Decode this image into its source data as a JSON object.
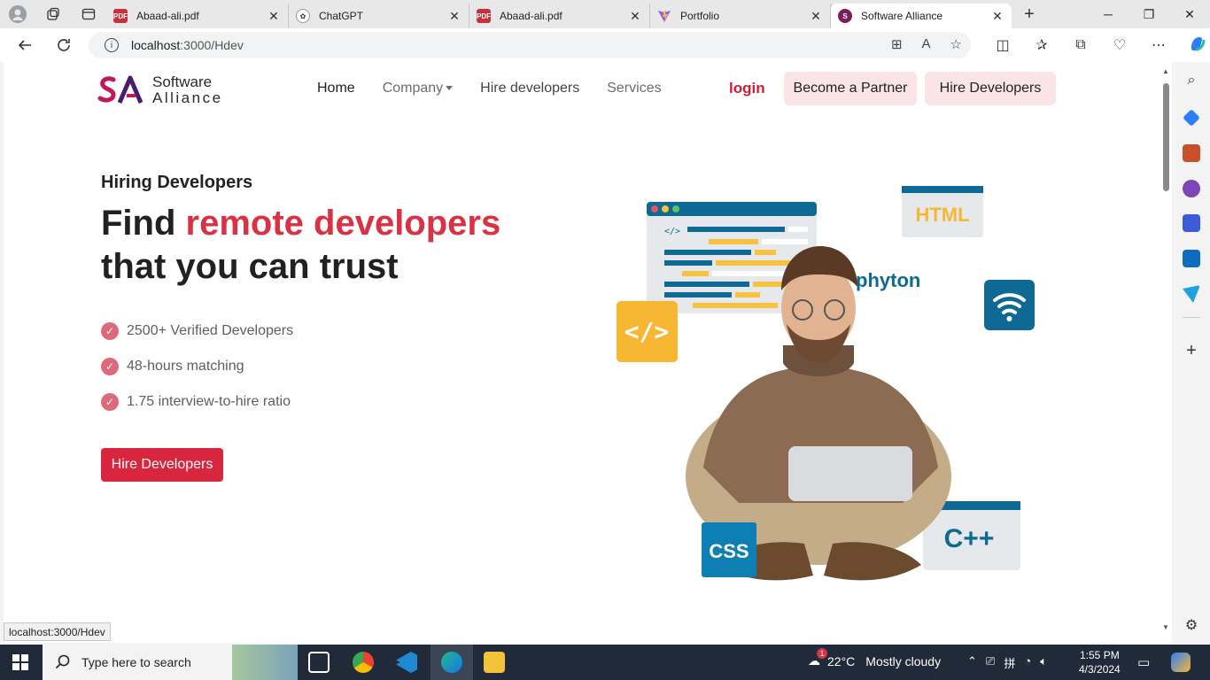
{
  "browser": {
    "tabs": [
      {
        "title": "Abaad-ali.pdf",
        "icon": "pdf-icon"
      },
      {
        "title": "ChatGPT",
        "icon": "chatgpt-icon"
      },
      {
        "title": "Abaad-ali.pdf",
        "icon": "pdf-icon"
      },
      {
        "title": "Portfolio",
        "icon": "vite-icon"
      },
      {
        "title": "Software Alliance",
        "icon": "software-alliance-icon",
        "active": true
      }
    ],
    "url_host": "localhost",
    "url_path": ":3000/Hdev",
    "status_url": "localhost:3000/Hdev"
  },
  "site": {
    "logo": {
      "line1": "Software",
      "line2": "Alliance"
    },
    "nav": {
      "home": "Home",
      "company": "Company",
      "hire": "Hire developers",
      "services": "Services"
    },
    "login": "login",
    "partner_button": "Become a Partner",
    "hire_button": "Hire Developers"
  },
  "hero": {
    "eyebrow": "Hiring Developers",
    "headline_prefix": "Find ",
    "headline_accent": "remote developers",
    "headline_line2": "that you can trust",
    "features": [
      "2500+ Verified Developers",
      "48-hours matching",
      "1.75 interview-to-hire ratio"
    ],
    "cta": "Hire Developers",
    "art_labels": {
      "html": "HTML",
      "python": "phyton",
      "css": "CSS",
      "cpp": "C++",
      "code": "</>",
      "small_code": "</>"
    }
  },
  "taskbar": {
    "search_placeholder": "Type here to search",
    "temperature": "22°C",
    "weather": "Mostly cloudy",
    "weather_badge": "1",
    "time": "1:55 PM",
    "date": "4/3/2024"
  },
  "colors": {
    "accent": "#d7263d",
    "accent_text": "#d93245",
    "pill_bg": "#fbe4e8",
    "taskbar": "#202a38"
  }
}
